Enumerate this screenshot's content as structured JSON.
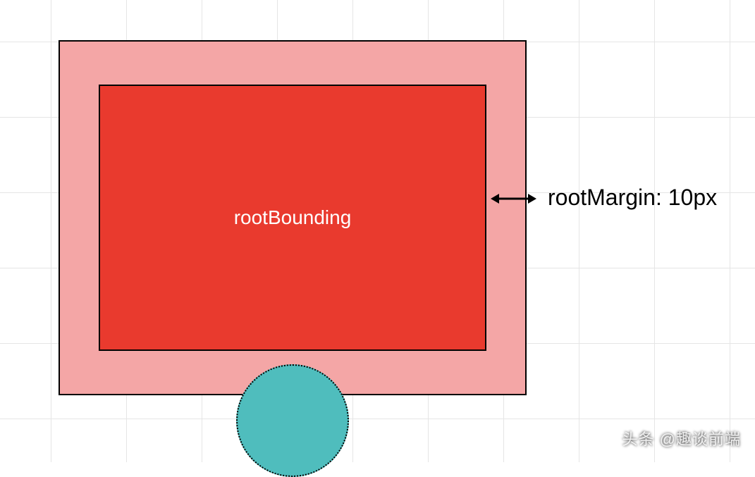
{
  "diagram": {
    "inner_label": "rootBounding",
    "margin_label": "rootMargin: 10px"
  },
  "watermark": "头条 @趣谈前端"
}
